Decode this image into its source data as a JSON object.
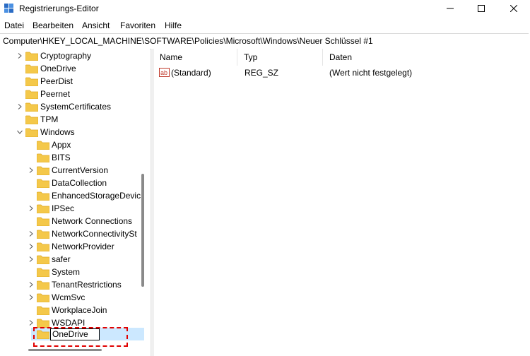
{
  "window": {
    "title": "Registrierungs-Editor"
  },
  "menu": [
    "Datei",
    "Bearbeiten",
    "Ansicht",
    "Favoriten",
    "Hilfe"
  ],
  "address": "Computer\\HKEY_LOCAL_MACHINE\\SOFTWARE\\Policies\\Microsoft\\Windows\\Neuer Schlüssel #1",
  "tree": [
    {
      "label": "Cryptography",
      "expander": "collapsed",
      "level": 1
    },
    {
      "label": "OneDrive",
      "expander": "none",
      "level": 1
    },
    {
      "label": "PeerDist",
      "expander": "none",
      "level": 1
    },
    {
      "label": "Peernet",
      "expander": "none",
      "level": 1
    },
    {
      "label": "SystemCertificates",
      "expander": "collapsed",
      "level": 1
    },
    {
      "label": "TPM",
      "expander": "none",
      "level": 1
    },
    {
      "label": "Windows",
      "expander": "expanded",
      "level": 1
    },
    {
      "label": "Appx",
      "expander": "none",
      "level": 2
    },
    {
      "label": "BITS",
      "expander": "none",
      "level": 2
    },
    {
      "label": "CurrentVersion",
      "expander": "collapsed",
      "level": 2
    },
    {
      "label": "DataCollection",
      "expander": "none",
      "level": 2
    },
    {
      "label": "EnhancedStorageDevic",
      "expander": "none",
      "level": 2
    },
    {
      "label": "IPSec",
      "expander": "collapsed",
      "level": 2
    },
    {
      "label": "Network Connections",
      "expander": "none",
      "level": 2
    },
    {
      "label": "NetworkConnectivitySt",
      "expander": "collapsed",
      "level": 2
    },
    {
      "label": "NetworkProvider",
      "expander": "collapsed",
      "level": 2
    },
    {
      "label": "safer",
      "expander": "collapsed",
      "level": 2
    },
    {
      "label": "System",
      "expander": "none",
      "level": 2
    },
    {
      "label": "TenantRestrictions",
      "expander": "collapsed",
      "level": 2
    },
    {
      "label": "WcmSvc",
      "expander": "collapsed",
      "level": 2
    },
    {
      "label": "WorkplaceJoin",
      "expander": "none",
      "level": 2
    },
    {
      "label": "WSDAPI",
      "expander": "collapsed",
      "level": 2
    }
  ],
  "rename_value": "OneDrive",
  "columns": {
    "name": "Name",
    "type": "Typ",
    "data": "Daten"
  },
  "values": [
    {
      "name": "(Standard)",
      "type": "REG_SZ",
      "data": "(Wert nicht festgelegt)"
    }
  ],
  "colors": {
    "folder": "#f4c84a",
    "folder_dark": "#e0a921",
    "selection": "#cce8ff",
    "highlight": "#e00000"
  }
}
